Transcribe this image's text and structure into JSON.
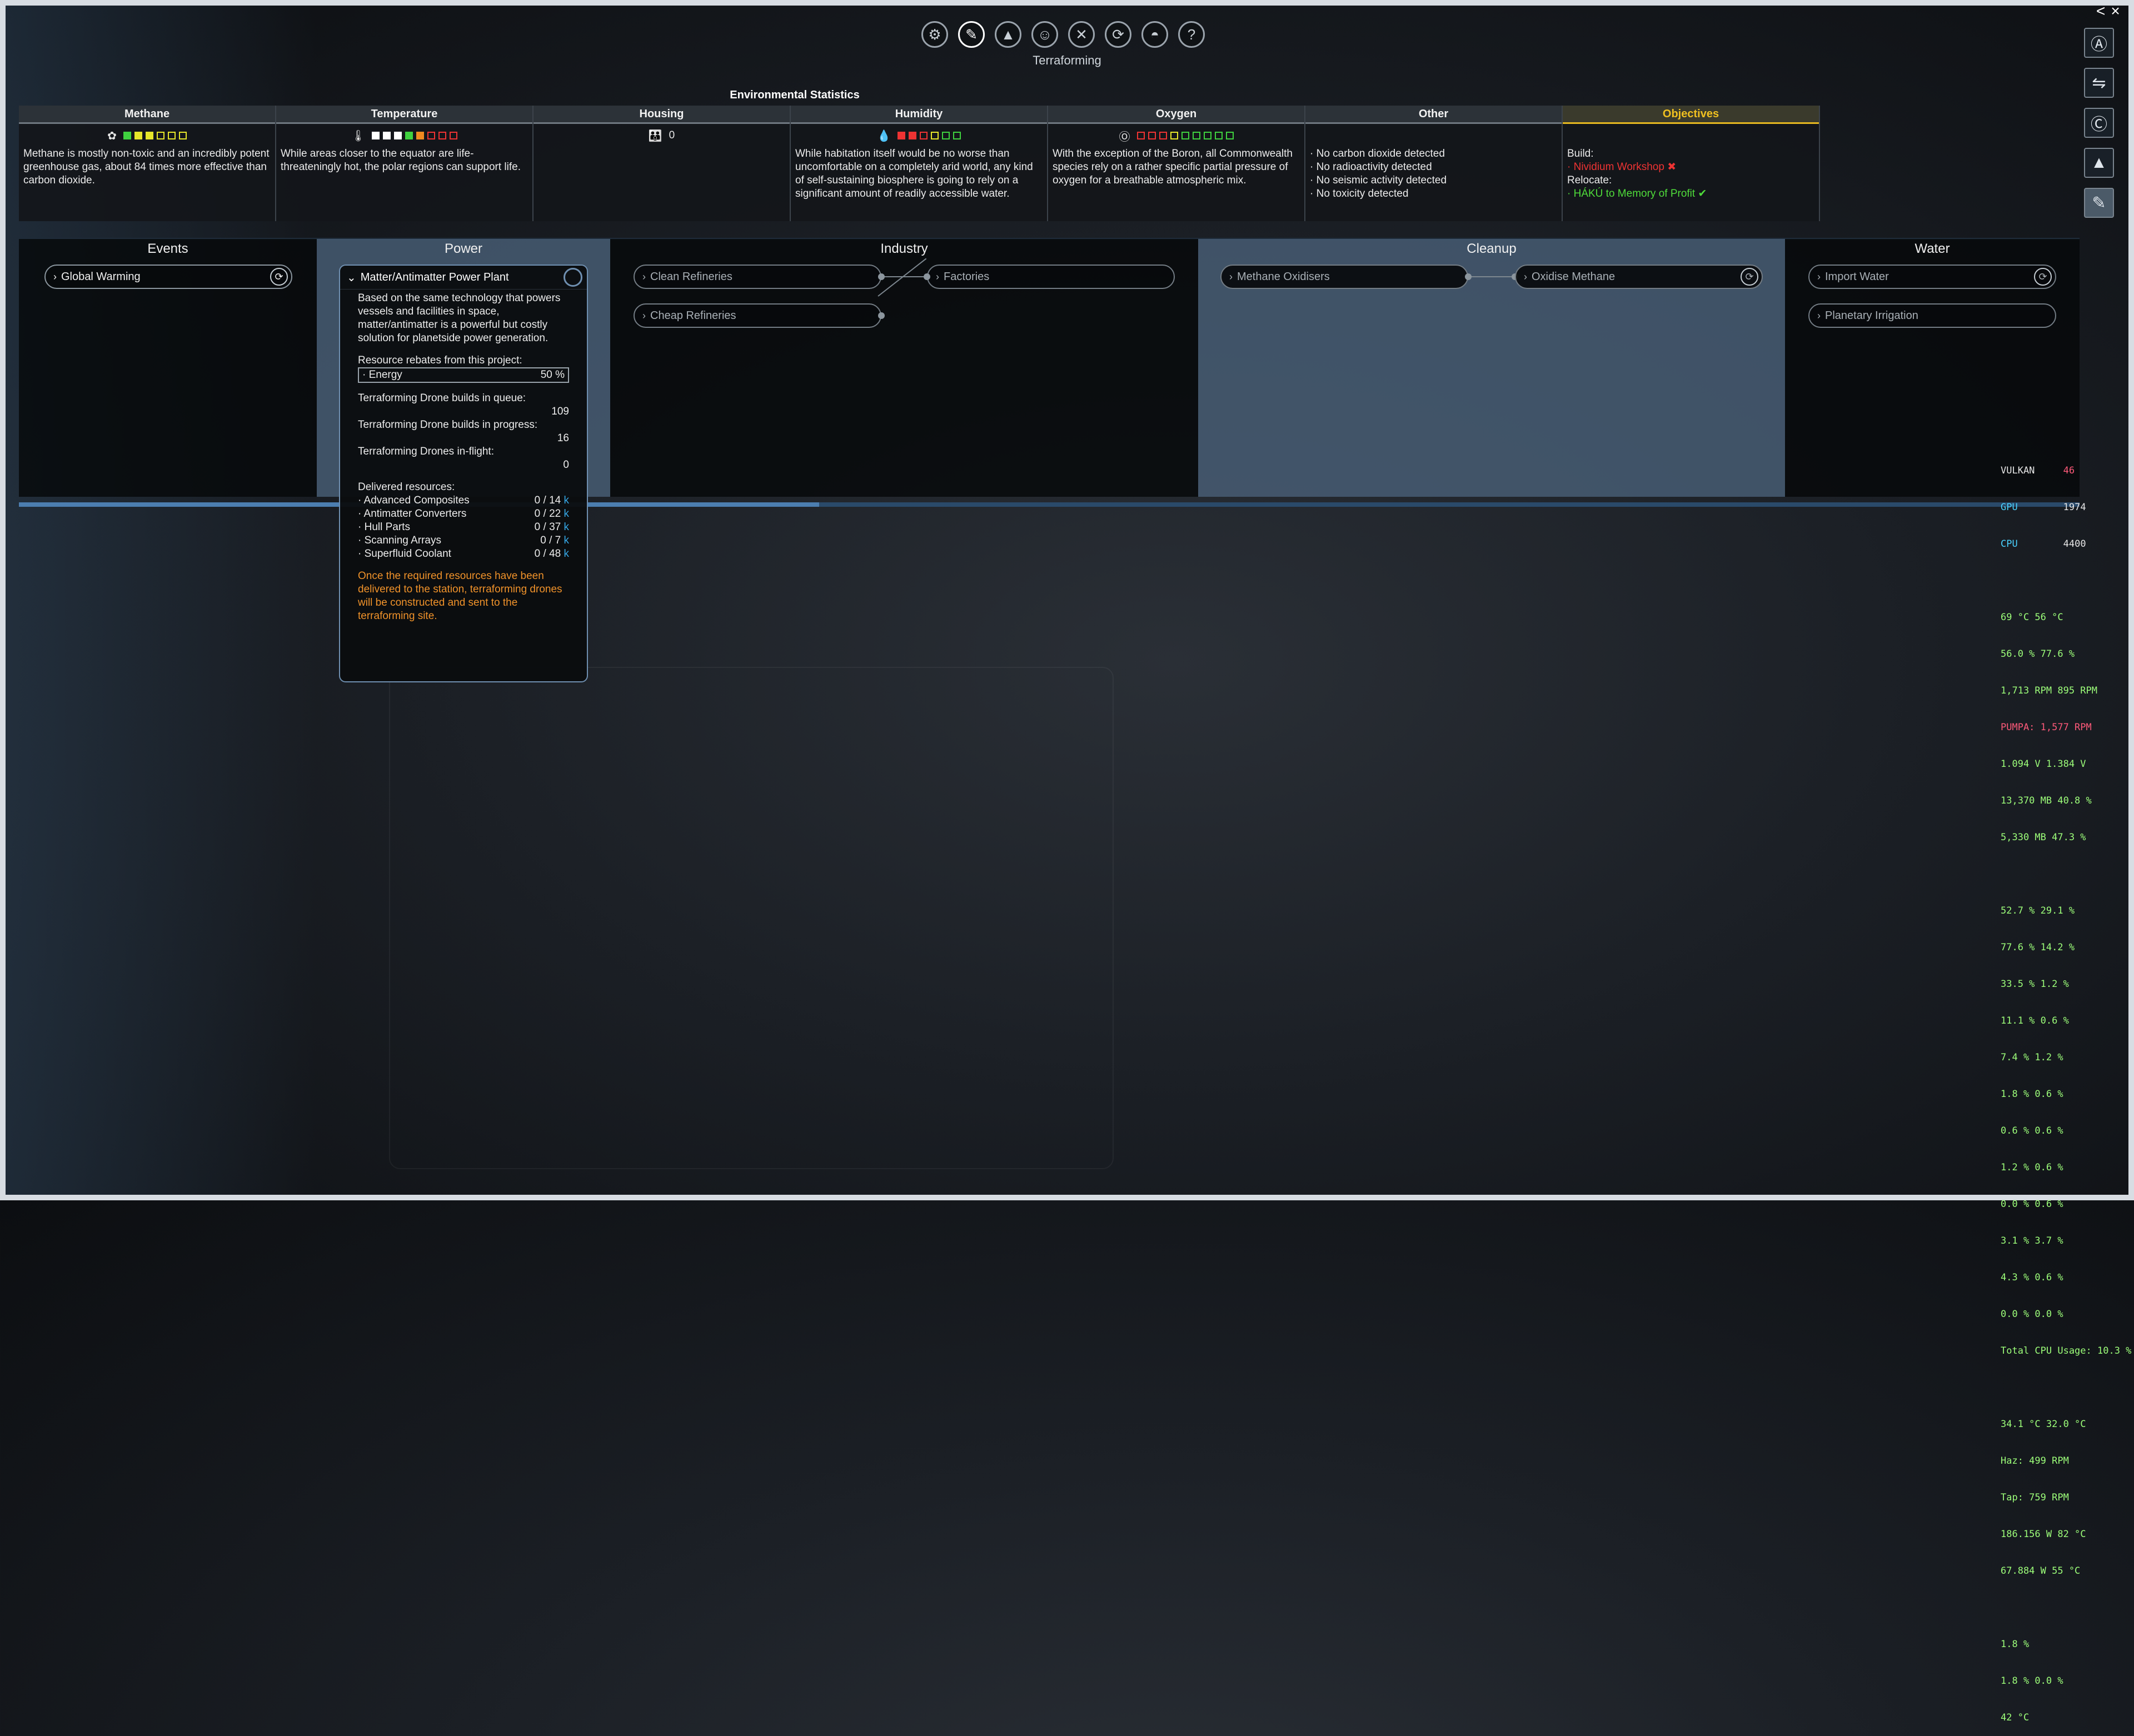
{
  "window": {
    "title": "Terraforming",
    "controls": [
      "<",
      "×"
    ]
  },
  "toolbar": {
    "icons": [
      "gear-icon",
      "terraforming-icon",
      "ship-icon",
      "character-icon",
      "crossed-tools-icon",
      "cycle-icon",
      "helmet-icon",
      "help-icon"
    ]
  },
  "sidebar": {
    "icons": [
      "a-icon",
      "network-icon",
      "c-icon",
      "ship-icon",
      "terraforming-icon"
    ]
  },
  "env": {
    "title": "Environmental Statistics",
    "columns": [
      {
        "label": "Methane",
        "desc": "Methane is mostly non-toxic and an incredibly potent greenhouse gas, about 84 times more effective than carbon dioxide."
      },
      {
        "label": "Temperature",
        "desc": "While areas closer to the equator are life-threateningly hot, the polar regions can support life."
      },
      {
        "label": "Housing",
        "value": "0"
      },
      {
        "label": "Humidity",
        "desc": "While habitation itself would be no worse than uncomfortable on a completely arid world, any kind of self-sustaining biosphere is going to rely on a significant amount of readily accessible water."
      },
      {
        "label": "Oxygen",
        "desc": "With the exception of the Boron, all Commonwealth species rely on a rather specific partial pressure of oxygen for a breathable atmospheric mix."
      },
      {
        "label": "Other",
        "items": [
          "· No carbon dioxide detected",
          "· No radioactivity detected",
          "· No seismic activity detected",
          "· No toxicity detected"
        ]
      },
      {
        "label": "Objectives",
        "build_label": "Build:",
        "build_item": "· Nividium Workshop",
        "relocate_label": "Relocate:",
        "relocate_item": "· HÁKÚ to Memory of Profit"
      }
    ]
  },
  "categories": {
    "events": {
      "title": "Events",
      "items": [
        "Global Warming"
      ]
    },
    "power": {
      "title": "Power"
    },
    "industry": {
      "title": "Industry",
      "items": [
        "Clean Refineries",
        "Factories",
        "Cheap Refineries"
      ]
    },
    "cleanup": {
      "title": "Cleanup",
      "items": [
        "Methane Oxidisers",
        "Oxidise Methane"
      ]
    },
    "water": {
      "title": "Water",
      "items": [
        "Import Water",
        "Planetary Irrigation"
      ]
    }
  },
  "project": {
    "name": "Matter/Antimatter Power Plant",
    "desc": "Based on the same technology that powers vessels and facilities in space, matter/antimatter is a powerful but costly solution for planetside power generation.",
    "rebates_label": "Resource rebates from this project:",
    "rebate_name": "· Energy",
    "rebate_value": "50 %",
    "queue_label": "Terraforming Drone builds in queue:",
    "queue_value": "109",
    "progress_label": "Terraforming Drone builds in progress:",
    "progress_value": "16",
    "inflight_label": "Terraforming Drones in-flight:",
    "inflight_value": "0",
    "delivered_label": "Delivered resources:",
    "resources": [
      {
        "name": "· Advanced Composites",
        "value": "0 / 14",
        "unit": "k"
      },
      {
        "name": "· Antimatter Converters",
        "value": "0 / 22",
        "unit": "k"
      },
      {
        "name": "· Hull Parts",
        "value": "0 / 37",
        "unit": "k"
      },
      {
        "name": "· Scanning Arrays",
        "value": "0 / 7",
        "unit": "k"
      },
      {
        "name": "· Superfluid Coolant",
        "value": "0 / 48",
        "unit": "k"
      }
    ],
    "note": "Once the required resources have been delivered to the station, terraforming drones will be constructed and sent to the terraforming site."
  },
  "osd": {
    "vulkan_label": "VULKAN",
    "vulkan_val": "46",
    "gpu_label": "GPU",
    "gpu_val": "1974",
    "cpu_label": "CPU",
    "cpu_val": "4400",
    "lines1": [
      "69 °C 56 °C",
      "56.0 % 77.6 %",
      "1,713 RPM 895 RPM",
      "PUMPA: 1,577 RPM",
      "1.094 V 1.384 V",
      "13,370 MB 40.8 %",
      "5,330 MB 47.3 %"
    ],
    "lines2": [
      "52.7 % 29.1 %",
      "77.6 % 14.2 %",
      "33.5 % 1.2 %",
      "11.1 % 0.6 %",
      "7.4 % 1.2 %",
      "1.8 % 0.6 %",
      "0.6 % 0.6 %",
      "1.2 % 0.6 %",
      "0.0 % 0.6 %",
      "3.1 % 3.7 %",
      "4.3 % 0.6 %",
      "0.0 % 0.0 %",
      "Total CPU Usage: 10.3 %"
    ],
    "lines3": [
      "34.1 °C 32.0 °C",
      "Haz: 499 RPM",
      "Tap: 759 RPM",
      "186.156 W 82 °C",
      "67.884 W 55 °C"
    ],
    "lines4": [
      "1.8 %",
      "1.8 % 0.0 %",
      "42 °C"
    ]
  },
  "colors": {
    "accent": "#4c7eb0",
    "objective": "#f0c020",
    "alert": "#e33333",
    "ok": "#4fdc3a",
    "note": "#f0922a"
  }
}
